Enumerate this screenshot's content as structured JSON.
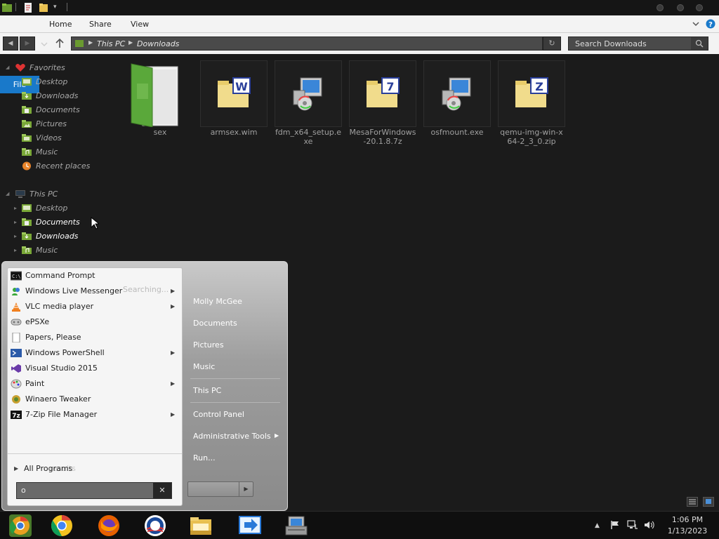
{
  "ribbon": {
    "tabs": [
      {
        "label": "File"
      },
      {
        "label": "Home"
      },
      {
        "label": "Share"
      },
      {
        "label": "View"
      }
    ]
  },
  "address": {
    "path": [
      "This PC",
      "Downloads"
    ]
  },
  "search": {
    "placeholder": "Search Downloads"
  },
  "sidebar": {
    "favorites_label": "Favorites",
    "favorites": [
      {
        "label": "Desktop",
        "icon": "desktop-folder-icon"
      },
      {
        "label": "Downloads",
        "icon": "downloads-folder-icon"
      },
      {
        "label": "Documents",
        "icon": "documents-folder-icon"
      },
      {
        "label": "Pictures",
        "icon": "pictures-folder-icon"
      },
      {
        "label": "Videos",
        "icon": "videos-folder-icon"
      },
      {
        "label": "Music",
        "icon": "music-folder-icon"
      },
      {
        "label": "Recent places",
        "icon": "recent-places-icon"
      }
    ],
    "thispc_label": "This PC",
    "thispc": [
      {
        "label": "Desktop",
        "icon": "desktop-folder-icon"
      },
      {
        "label": "Documents",
        "icon": "documents-folder-icon"
      },
      {
        "label": "Downloads",
        "icon": "downloads-folder-icon"
      },
      {
        "label": "Music",
        "icon": "music-folder-icon"
      }
    ]
  },
  "files": [
    {
      "name": "sex",
      "icon": "green-folder-icon"
    },
    {
      "name": "armsex.wim",
      "icon": "wim-archive-icon"
    },
    {
      "name": "fdm_x64_setup.exe",
      "icon": "installer-icon"
    },
    {
      "name": "MesaForWindows-20.1.8.7z",
      "icon": "7z-archive-icon"
    },
    {
      "name": "osfmount.exe",
      "icon": "installer-icon"
    },
    {
      "name": "qemu-img-win-x64-2_3_0.zip",
      "icon": "zip-archive-icon"
    }
  ],
  "start_menu": {
    "programs": [
      {
        "label": "Command Prompt",
        "icon": "cmd-icon",
        "submenu": false
      },
      {
        "label": "Windows Live Messenger",
        "icon": "messenger-icon",
        "submenu": true
      },
      {
        "label": "VLC media player",
        "icon": "vlc-icon",
        "submenu": true
      },
      {
        "label": "ePSXe",
        "icon": "gamepad-icon",
        "submenu": false
      },
      {
        "label": "Papers, Please",
        "icon": "document-icon",
        "submenu": false
      },
      {
        "label": "Windows PowerShell",
        "icon": "powershell-icon",
        "submenu": true
      },
      {
        "label": "Visual Studio 2015",
        "icon": "visual-studio-icon",
        "submenu": false
      },
      {
        "label": "Paint",
        "icon": "paint-icon",
        "submenu": true
      },
      {
        "label": "Winaero Tweaker",
        "icon": "tweaker-icon",
        "submenu": false
      },
      {
        "label": "7-Zip File Manager",
        "icon": "7zip-icon",
        "submenu": true
      }
    ],
    "searching_text": "Searching...",
    "all_programs": "All Programs",
    "ghost_text": "results",
    "search_value": "o",
    "right_panel": [
      "Molly McGee",
      "Documents",
      "Pictures",
      "Music",
      "This PC",
      "Control Panel",
      "Administrative Tools",
      "Run..."
    ]
  },
  "taskbar": {
    "apps": [
      "chrome-canary-icon",
      "chrome-icon",
      "firefox-icon",
      "obama-logo-icon",
      "file-explorer-icon",
      "remote-desktop-icon",
      "setup-icon"
    ],
    "time": "1:06 PM",
    "date": "1/13/2023"
  }
}
